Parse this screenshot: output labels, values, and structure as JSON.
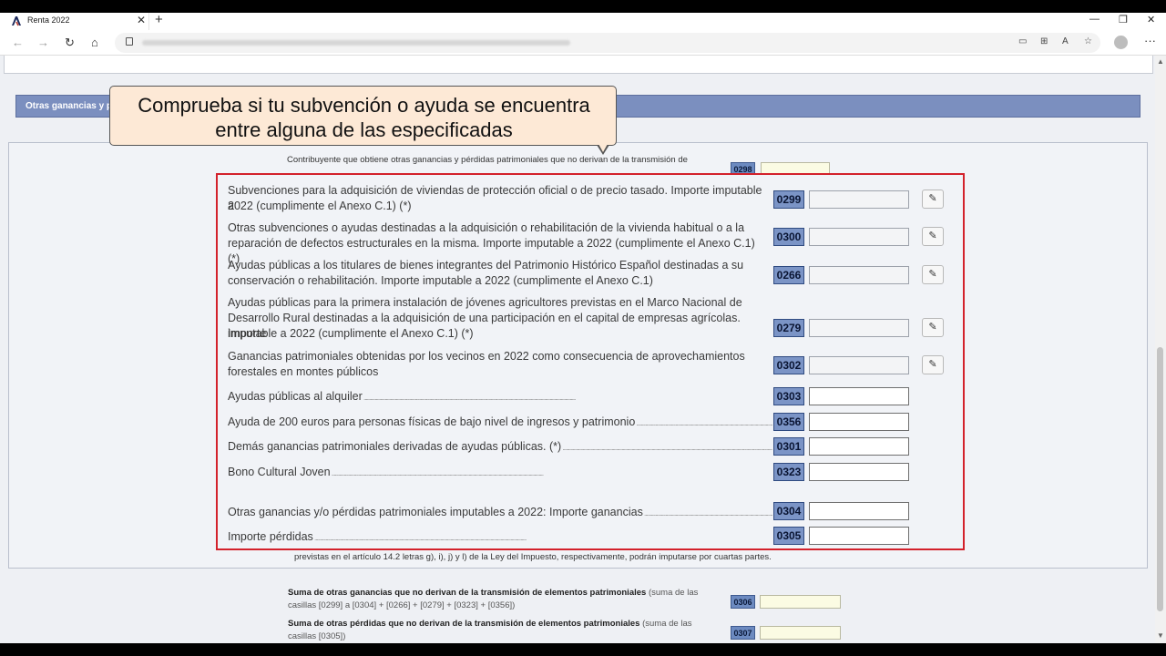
{
  "browser": {
    "tab_title": "Renta 2022",
    "tab_close": "✕",
    "new_tab": "+",
    "win_min": "—",
    "win_max": "❐",
    "win_close": "✕",
    "back": "←",
    "forward": "→",
    "reload": "↻",
    "home": "⌂",
    "menu": "···",
    "url_icons": [
      "▭",
      "⊞",
      "A",
      "☆"
    ]
  },
  "section": {
    "header": "Otras ganancias y pé"
  },
  "callout": {
    "line1": "Comprueba si tu subvención o ayuda se encuentra",
    "line2": "entre alguna de las especificadas"
  },
  "top_row": {
    "label": "Contribuyente que obtiene otras ganancias y pérdidas patrimoniales que no derivan de la transmisión de elementos patrimoniales",
    "code": "0298"
  },
  "rows": [
    {
      "line1": "Subvenciones para la adquisición de viviendas de protección oficial o de precio tasado. Importe imputable a",
      "line2": "2022 (cumplimente el Anexo C.1) (*)",
      "code": "0299",
      "edit": "✎"
    },
    {
      "line1": "Otras subvenciones o ayudas destinadas a la adquisición o rehabilitación de la vivienda habitual o a la",
      "line2": "reparación de defectos estructurales en la misma. Importe imputable a 2022 (cumplimente el Anexo C.1) (*)",
      "code": "0300",
      "edit": "✎"
    },
    {
      "line1": "Ayudas públicas a los titulares de bienes integrantes del Patrimonio Histórico Español destinadas a su",
      "line2": "conservación o rehabilitación. Importe imputable a 2022 (cumplimente el Anexo C.1)",
      "code": "0266",
      "edit": "✎"
    },
    {
      "line1": "Ayudas públicas para la primera instalación de jóvenes agricultores previstas en el Marco Nacional de",
      "line2": "Desarrollo Rural destinadas a la adquisición de una participación en el capital de empresas agrícolas. Importe",
      "line3": "imputable a 2022 (cumplimente el Anexo C.1) (*)",
      "code": "0279",
      "edit": "✎"
    },
    {
      "line1": "Ganancias patrimoniales obtenidas por los vecinos en 2022 como consecuencia de aprovechamientos",
      "line2": "forestales en montes públicos",
      "code": "0302",
      "edit": "✎"
    },
    {
      "line1": "Ayudas públicas al alquiler",
      "code": "0303"
    },
    {
      "line1": "Ayuda de 200 euros para personas físicas de bajo nivel de ingresos y patrimonio",
      "code": "0356"
    },
    {
      "line1": "Demás ganancias patrimoniales derivadas de ayudas públicas. (*)",
      "code": "0301"
    },
    {
      "line1": "Bono Cultural Joven",
      "code": "0323"
    },
    {
      "line1": "Otras ganancias y/o pérdidas patrimoniales imputables a 2022: Importe ganancias",
      "code": "0304"
    },
    {
      "line1": "Importe pérdidas",
      "code": "0305"
    }
  ],
  "footnote": "previstas en el artículo 14.2 letras g), i), j) y l) de la Ley del Impuesto, respectivamente, podrán imputarse por cuartas partes.",
  "sums": [
    {
      "bold": "Suma de otras ganancias que no derivan de la transmisión de elementos patrimoniales",
      "rest": " (suma de las",
      "line2": "casillas [0299] a [0304] + [0266] + [0279] + [0323] + [0356])",
      "code": "0306"
    },
    {
      "bold": "Suma de otras pérdidas que no derivan de la transmisión de elementos patrimoniales",
      "rest": " (suma de las",
      "line2": "casillas [0305])",
      "code": "0307"
    }
  ]
}
